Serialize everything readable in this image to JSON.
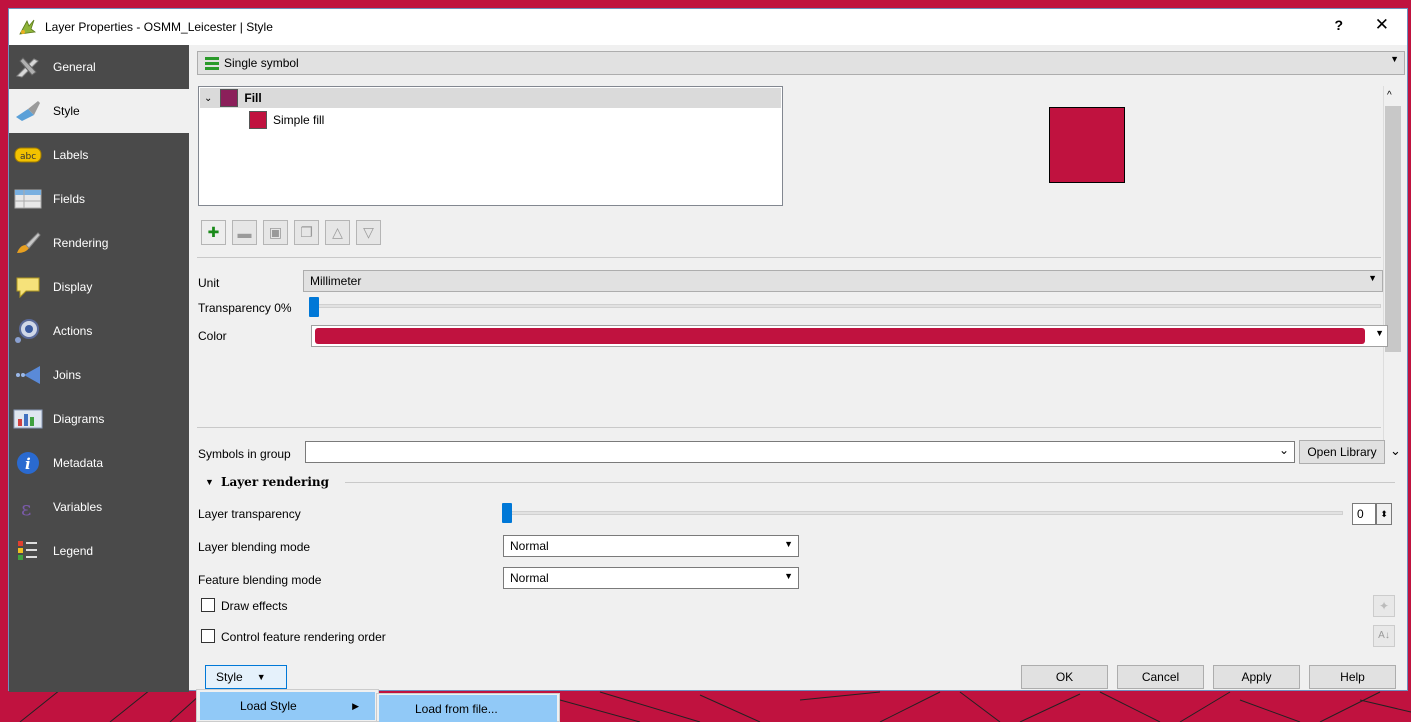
{
  "window": {
    "title": "Layer Properties - OSMM_Leicester | Style",
    "help_glyph": "?",
    "close_glyph": "✕"
  },
  "sidebar": {
    "items": [
      {
        "label": "General",
        "icon": "general-icon"
      },
      {
        "label": "Style",
        "icon": "style-icon"
      },
      {
        "label": "Labels",
        "icon": "labels-icon"
      },
      {
        "label": "Fields",
        "icon": "fields-icon"
      },
      {
        "label": "Rendering",
        "icon": "rendering-icon"
      },
      {
        "label": "Display",
        "icon": "display-icon"
      },
      {
        "label": "Actions",
        "icon": "actions-icon"
      },
      {
        "label": "Joins",
        "icon": "joins-icon"
      },
      {
        "label": "Diagrams",
        "icon": "diagrams-icon"
      },
      {
        "label": "Metadata",
        "icon": "metadata-icon"
      },
      {
        "label": "Variables",
        "icon": "variables-icon"
      },
      {
        "label": "Legend",
        "icon": "legend-icon"
      }
    ],
    "active": "Style"
  },
  "renderer": {
    "selected": "Single symbol"
  },
  "symbol_tree": {
    "root": "Fill",
    "child": "Simple fill",
    "root_color": "#8b1f5a",
    "child_color": "#c0123f"
  },
  "symbol_props": {
    "unit_label": "Unit",
    "unit_value": "Millimeter",
    "transparency_label": "Transparency 0%",
    "transparency_value": 0,
    "color_label": "Color",
    "color_value": "#c0123f"
  },
  "library": {
    "symbols_in_group_label": "Symbols in group",
    "symbols_in_group_value": "",
    "open_library_label": "Open Library"
  },
  "layer_rendering": {
    "section_title": "Layer rendering",
    "layer_transparency_label": "Layer transparency",
    "layer_transparency_value": "0",
    "layer_blending_label": "Layer blending mode",
    "layer_blending_value": "Normal",
    "feature_blending_label": "Feature blending mode",
    "feature_blending_value": "Normal",
    "draw_effects_label": "Draw effects",
    "draw_effects_checked": false,
    "control_order_label": "Control feature rendering order",
    "control_order_checked": false
  },
  "buttons": {
    "style_menu": "Style",
    "ok": "OK",
    "cancel": "Cancel",
    "apply": "Apply",
    "help": "Help"
  },
  "style_menu": {
    "item": "Load Style",
    "submenu_item": "Load from file..."
  },
  "colors": {
    "sidebar_bg": "#4a4a4a",
    "accent": "#0078d7",
    "fill_color": "#c0123f",
    "menu_highlight": "#91c9f7"
  }
}
